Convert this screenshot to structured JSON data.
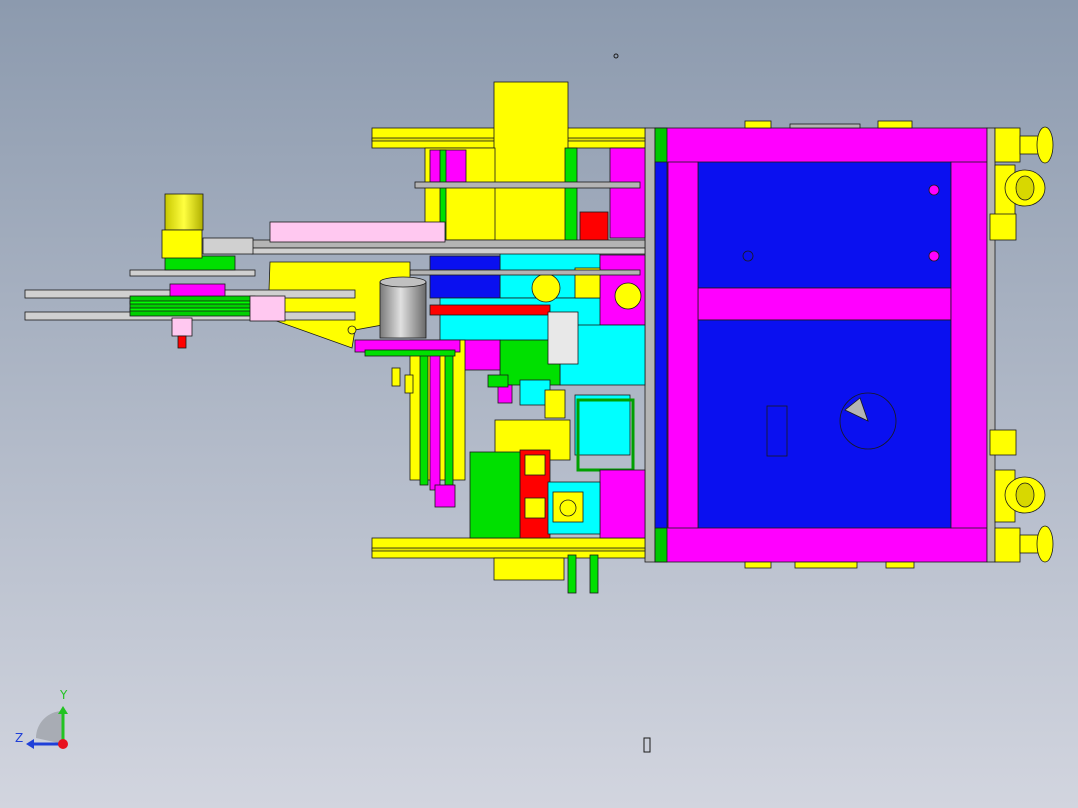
{
  "viewport": {
    "background_top": "#8c9aae",
    "background_bottom": "#d2d5df"
  },
  "triad": {
    "y_label": "Y",
    "z_label": "Z",
    "y_color": "#22c322",
    "z_color": "#1f3fd8",
    "origin_color": "#e8101e"
  },
  "palette": {
    "magenta": "#ff00ff",
    "blue": "#0a10f0",
    "yellow": "#ffff00",
    "green": "#00e000",
    "cyan": "#00ffff",
    "red": "#ff0000",
    "gray": "#b4b4b4",
    "pink": "#ffc8f0",
    "dark_green": "#008000",
    "outline": "#1a1a1a"
  }
}
